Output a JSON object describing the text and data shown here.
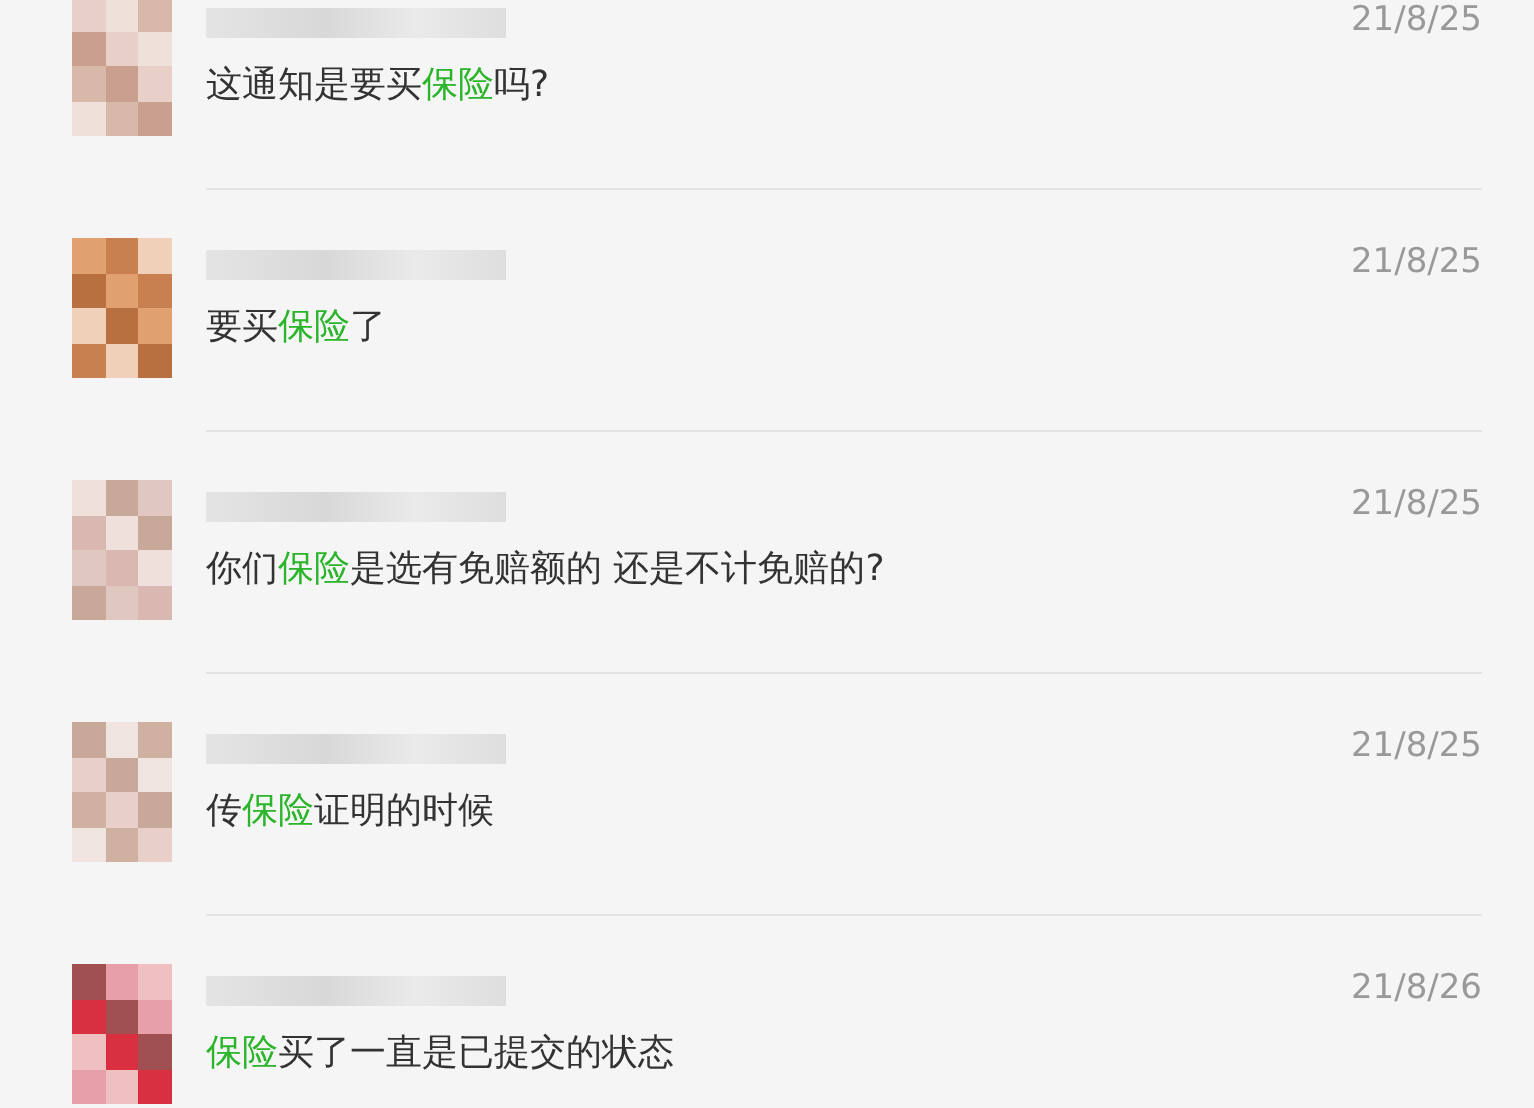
{
  "messages": [
    {
      "date": "21/8/25",
      "text": [
        {
          "text": "这通知是要买",
          "highlight": false
        },
        {
          "text": "保险",
          "highlight": true
        },
        {
          "text": "吗?",
          "highlight": false
        }
      ]
    },
    {
      "date": "21/8/25",
      "text": [
        {
          "text": "要买",
          "highlight": false
        },
        {
          "text": "保险",
          "highlight": true
        },
        {
          "text": "了",
          "highlight": false
        }
      ]
    },
    {
      "date": "21/8/25",
      "text": [
        {
          "text": "你们",
          "highlight": false
        },
        {
          "text": "保险",
          "highlight": true
        },
        {
          "text": "是选有免赔额的 还是不计免赔的?",
          "highlight": false
        }
      ]
    },
    {
      "date": "21/8/25",
      "text": [
        {
          "text": "传",
          "highlight": false
        },
        {
          "text": "保险",
          "highlight": true
        },
        {
          "text": "证明的时候",
          "highlight": false
        }
      ]
    },
    {
      "date": "21/8/26",
      "text": [
        {
          "text": "保险",
          "highlight": true
        },
        {
          "text": "买了一直是已提交的状态",
          "highlight": false
        }
      ]
    }
  ]
}
